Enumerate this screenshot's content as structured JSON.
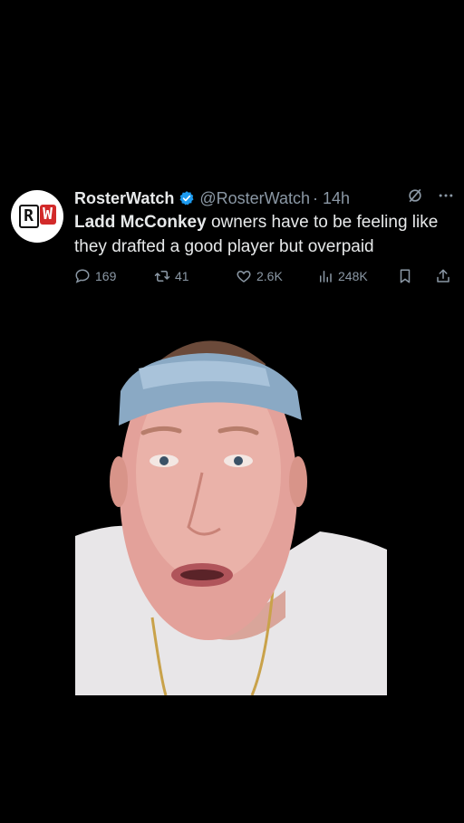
{
  "tweet": {
    "author_name": "RosterWatch",
    "handle": "@RosterWatch",
    "time": "· 14h",
    "avatar_letters": [
      "R",
      "W"
    ],
    "text_bold": "Ladd McConkey",
    "text_rest": " owners have to be feeling like they drafted a good player but overpaid",
    "stats": {
      "replies": "169",
      "retweets": "41",
      "likes": "2.6K",
      "views": "248K"
    }
  },
  "icons": [
    "verified-badge-icon",
    "grok-icon",
    "more-icon",
    "reply-icon",
    "retweet-icon",
    "like-icon",
    "views-icon",
    "bookmark-icon",
    "share-icon"
  ],
  "colors": {
    "background": "#000000",
    "text": "#e7e9ea",
    "muted": "#8b98a5",
    "verified": "#1d9bf0",
    "logo_red": "#d22a2a"
  }
}
